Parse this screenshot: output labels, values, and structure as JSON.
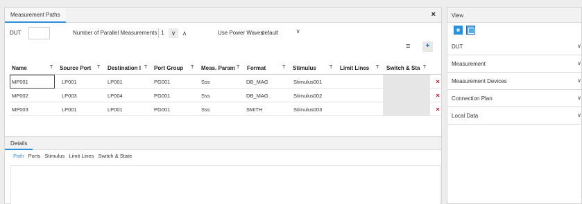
{
  "left_panel": {
    "tab_title": "Measurement Paths",
    "close_label": "×",
    "dut_label": "DUT",
    "parallel_label": "Number of Parallel Measurements",
    "parallel_value": "1",
    "spin_down": "∨",
    "spin_up": "∧",
    "power_waves_label": "Use Power Waves",
    "power_waves_value": "default",
    "power_waves_chevron": "∨",
    "menu_glyph": "≡",
    "add_glyph": "+"
  },
  "table": {
    "columns": [
      "Name",
      "Source Port",
      "Destination I",
      "Port Group",
      "Meas. Param",
      "Format",
      "Stimulus",
      "Limit Lines",
      "Switch & Sta"
    ],
    "filter_glyph": "T",
    "delete_glyph": "×",
    "rows": [
      {
        "name": "MP001",
        "source": "LP001",
        "destination": "LP001",
        "port_group": "PG001",
        "param": "Sss",
        "format": "DB_MAG",
        "stimulus": "Stimulus001"
      },
      {
        "name": "MP002",
        "source": "LP003",
        "destination": "LP004",
        "port_group": "PG001",
        "param": "Sss",
        "format": "DB_MAG",
        "stimulus": "Stimulus002"
      },
      {
        "name": "MP003",
        "source": "LP001",
        "destination": "LP001",
        "port_group": "PG001",
        "param": "Sss",
        "format": "SMITH",
        "stimulus": "Stimulus003"
      }
    ]
  },
  "details": {
    "tab_title": "Details",
    "subtabs": [
      "Path",
      "Ports",
      "Stimulus",
      "Limit Lines",
      "Switch & State"
    ]
  },
  "view_panel": {
    "title": "View",
    "sections": [
      "DUT",
      "Measurement",
      "Measurement Devices",
      "Connection Plan",
      "Local Data"
    ],
    "chevron": "∨"
  },
  "colors": {
    "accent": "#2b8fd9",
    "delete": "#d0021b"
  }
}
